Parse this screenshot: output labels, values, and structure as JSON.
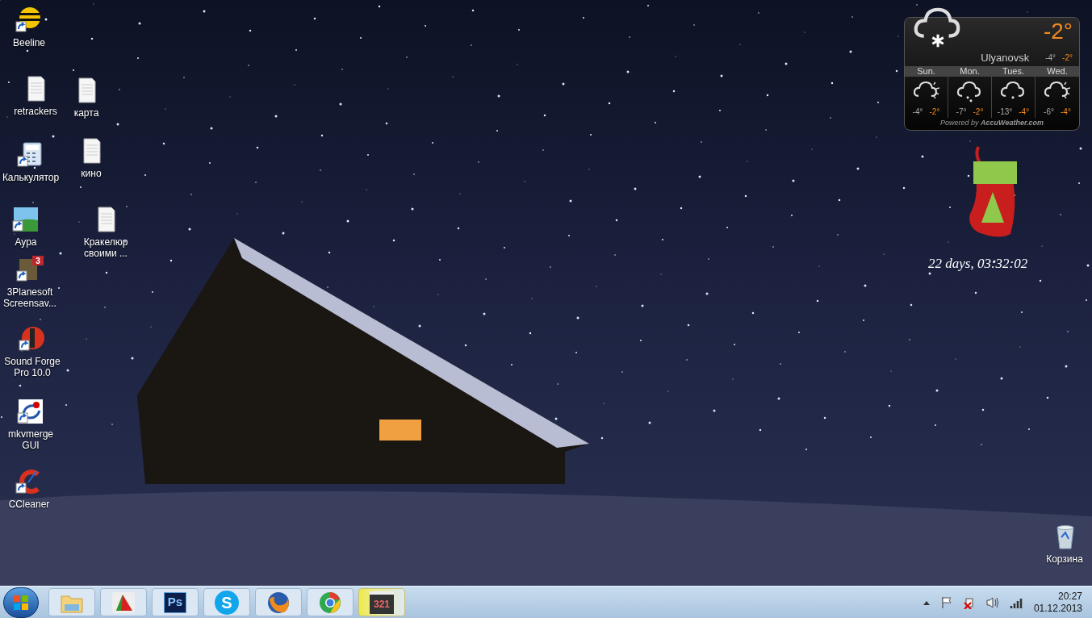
{
  "desktop_icons": [
    {
      "label": "Beeline",
      "kind": "beeline",
      "shortcut": true
    },
    {
      "label": "retrackers",
      "kind": "document",
      "shortcut": false
    },
    {
      "label": "карта",
      "kind": "document",
      "shortcut": false
    },
    {
      "label": "Калькулятор",
      "kind": "calculator",
      "shortcut": true
    },
    {
      "label": "кино",
      "kind": "document",
      "shortcut": false
    },
    {
      "label": "Аура",
      "kind": "landscape",
      "shortcut": true
    },
    {
      "label": "Кракелюр своими ...",
      "kind": "document",
      "shortcut": false
    },
    {
      "label": "3Planesoft Screensav...",
      "kind": "screensaver",
      "shortcut": true,
      "badge": "3"
    },
    {
      "label": "Sound Forge Pro 10.0",
      "kind": "sound-forge",
      "shortcut": true
    },
    {
      "label": "mkvmerge GUI",
      "kind": "mkvmerge",
      "shortcut": true
    },
    {
      "label": "CCleaner",
      "kind": "ccleaner",
      "shortcut": true
    },
    {
      "label": "Корзина",
      "kind": "recycle-bin",
      "shortcut": false
    }
  ],
  "weather": {
    "temperature": "-2°",
    "city": "Ulyanovsk",
    "low": "-4°",
    "high": "-2°",
    "days": [
      {
        "name": "Sun.",
        "kind": "partly-cloudy",
        "low": "-4°",
        "high": "-2°"
      },
      {
        "name": "Mon.",
        "kind": "snow",
        "low": "-7°",
        "high": "-2°"
      },
      {
        "name": "Tues.",
        "kind": "light-snow",
        "low": "-13°",
        "high": "-4°"
      },
      {
        "name": "Wed.",
        "kind": "partly-cloudy",
        "low": "-6°",
        "high": "-4°"
      }
    ],
    "footer": "Powered by **AccuWeather.com**"
  },
  "countdown": "22 days, 03:32:02",
  "taskbar": {
    "items": [
      {
        "kind": "folder",
        "highlighted": false
      },
      {
        "kind": "fan",
        "highlighted": false
      },
      {
        "kind": "ps",
        "label": "Ps",
        "highlighted": false
      },
      {
        "kind": "skype",
        "label": "S",
        "highlighted": false
      },
      {
        "kind": "firefox",
        "highlighted": false
      },
      {
        "kind": "chrome",
        "highlighted": false
      },
      {
        "kind": "clapper",
        "label": "321",
        "highlighted": true
      }
    ],
    "time": "20:27",
    "date": "01.12.2013"
  }
}
